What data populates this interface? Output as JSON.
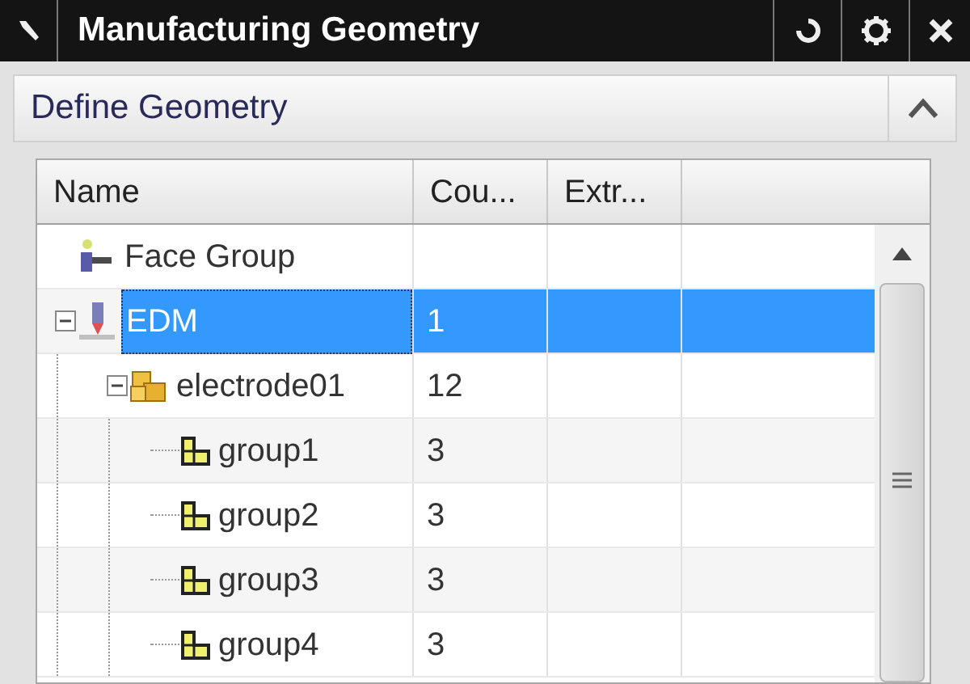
{
  "window": {
    "title": "Manufacturing Geometry"
  },
  "section": {
    "title": "Define Geometry",
    "expanded": true
  },
  "table": {
    "columns": [
      "Name",
      "Cou...",
      "Extr..."
    ],
    "rows": [
      {
        "name": "Face Group",
        "kind": "face-group",
        "selected": false
      },
      {
        "name": "EDM",
        "kind": "edm",
        "count": "1",
        "selected": true,
        "expanded": true,
        "children": [
          {
            "name": "electrode01",
            "kind": "electrode",
            "count": "12",
            "selected": false,
            "expanded": true,
            "children": [
              {
                "name": "group1",
                "kind": "group",
                "count": "3",
                "selected": false
              },
              {
                "name": "group2",
                "kind": "group",
                "count": "3",
                "selected": false
              },
              {
                "name": "group3",
                "kind": "group",
                "count": "3",
                "selected": false
              },
              {
                "name": "group4",
                "kind": "group",
                "count": "3",
                "selected": false
              }
            ]
          }
        ]
      }
    ]
  }
}
